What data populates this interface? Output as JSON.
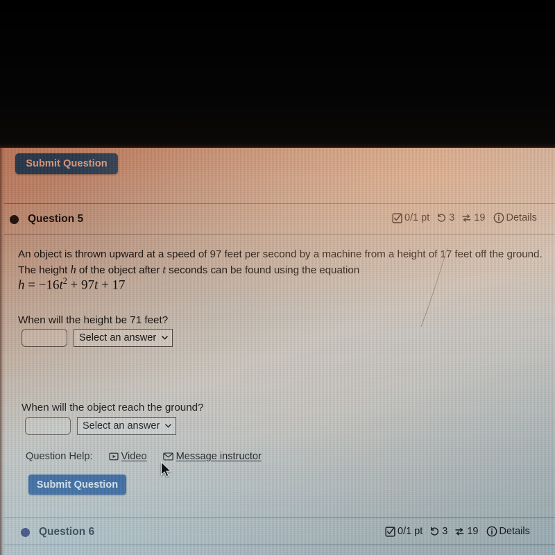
{
  "top_bar": {
    "submit_label": "Submit Question"
  },
  "question5": {
    "bullet_color": "#241a16",
    "title": "Question 5",
    "status": {
      "points_icon": "checkbox-check-icon",
      "points": "0/1 pt",
      "attempts_icon": "undo-arrow-icon",
      "attempts": "3",
      "refresh_icon": "cycle-arrows-icon",
      "refresh_count": "19",
      "details_icon": "info-circle-icon",
      "details_label": "Details"
    },
    "problem": {
      "line1_a": "An object is thrown upward at a speed of 97 feet per second by a machine from a height of 17 feet",
      "line2_a": "off the ground. The height ",
      "line2_var1": "h",
      "line2_b": " of the object after ",
      "line2_var2": "t",
      "line2_c": " seconds can be found using the equation",
      "equation_plain": "h = − 16t² + 97t + 17",
      "eq_lhs": "h",
      "eq_eq": "=",
      "eq_minus": "−",
      "eq_coef1": "16",
      "eq_var1": "t",
      "eq_pow1": "2",
      "eq_plus1": "+",
      "eq_coef2": "97",
      "eq_var2": "t",
      "eq_plus2": "+",
      "eq_const": "17"
    },
    "part_a": {
      "prompt": "When will the height be 71 feet?",
      "input_value": "",
      "input_placeholder": "",
      "select_value": "Select an answer"
    },
    "part_b": {
      "prompt": "When will the object reach the ground?",
      "input_value": "",
      "input_placeholder": "",
      "select_value": "Select an answer"
    },
    "help": {
      "label": "Question Help:",
      "video_icon": "play-video-icon",
      "video_label": "Video",
      "message_icon": "envelope-icon",
      "message_label": "Message instructor"
    },
    "submit_label": "Submit Question"
  },
  "question6": {
    "bullet_color": "#2a2a6e",
    "title": "Question 6",
    "status": {
      "points_icon": "checkbox-check-icon",
      "points": "0/1 pt",
      "attempts_icon": "undo-arrow-icon",
      "attempts": "3",
      "refresh_icon": "cycle-arrows-icon",
      "refresh_count": "19",
      "details_icon": "info-circle-icon",
      "details_label": "Details"
    }
  },
  "theme": {
    "button_blue": "#2e5e9e",
    "text_dark": "#17120f"
  }
}
